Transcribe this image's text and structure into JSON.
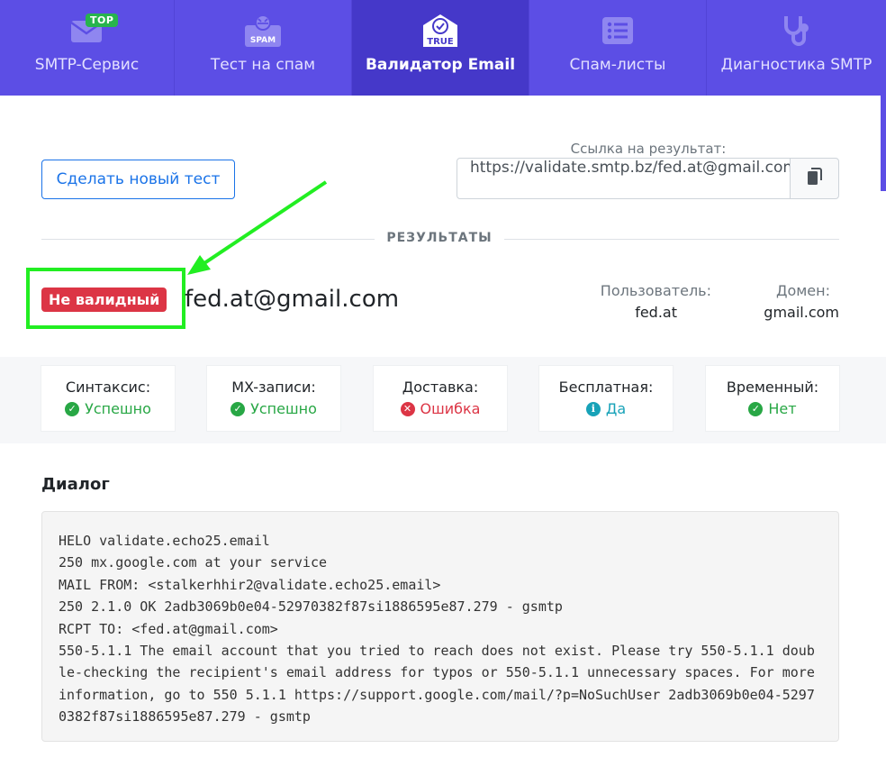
{
  "nav": {
    "items": [
      {
        "label": "SMTP-Сервис",
        "icon": "envelope-icon",
        "badge": "TOP",
        "active": false
      },
      {
        "label": "Тест на спам",
        "icon": "spam-icon",
        "icon_text": "SPAM",
        "active": false
      },
      {
        "label": "Валидатор Email",
        "icon": "true-badge-icon",
        "icon_text": "TRUE",
        "active": true
      },
      {
        "label": "Спам-листы",
        "icon": "list-icon",
        "active": false
      },
      {
        "label": "Диагностика SMTP",
        "icon": "stethoscope-icon",
        "active": false
      }
    ]
  },
  "actions": {
    "new_test_label": "Сделать новый тест"
  },
  "result_link": {
    "label": "Ссылка на результат:",
    "value": "https://validate.smtp.bz/fed.at@gmail.com",
    "copy_icon": "copy-icon"
  },
  "results": {
    "section_title": "РЕЗУЛЬТАТЫ",
    "status": "Не валидный",
    "email": "fed.at@gmail.com",
    "user_label": "Пользователь:",
    "user_value": "fed.at",
    "domain_label": "Домен:",
    "domain_value": "gmail.com"
  },
  "checks": [
    {
      "label": "Синтаксис:",
      "value": "Успешно",
      "status": "ok"
    },
    {
      "label": "MX-записи:",
      "value": "Успешно",
      "status": "ok"
    },
    {
      "label": "Доставка:",
      "value": "Ошибка",
      "status": "err"
    },
    {
      "label": "Бесплатная:",
      "value": "Да",
      "status": "info"
    },
    {
      "label": "Временный:",
      "value": "Нет",
      "status": "ok"
    }
  ],
  "dialog": {
    "title": "Диалог",
    "log": "HELO validate.echo25.email\n250 mx.google.com at your service\nMAIL FROM: <stalkerhhir2@validate.echo25.email>\n250 2.1.0 OK 2adb3069b0e04-52970382f87si1886595e87.279 - gsmtp\nRCPT TO: <fed.at@gmail.com>\n550-5.1.1 The email account that you tried to reach does not exist. Please try 550-5.1.1 double-checking the recipient's email address for typos or 550-5.1.1 unnecessary spaces. For more information, go to 550 5.1.1 https://support.google.com/mail/?p=NoSuchUser 2adb3069b0e04-52970382f87si1886595e87.279 - gsmtp"
  },
  "colors": {
    "nav_bg": "#5c4ee5",
    "nav_active": "#4538c9",
    "primary": "#1a73e8",
    "danger": "#dc3545",
    "success": "#28a745",
    "info": "#17a2b8",
    "annotation": "#22ee22"
  }
}
